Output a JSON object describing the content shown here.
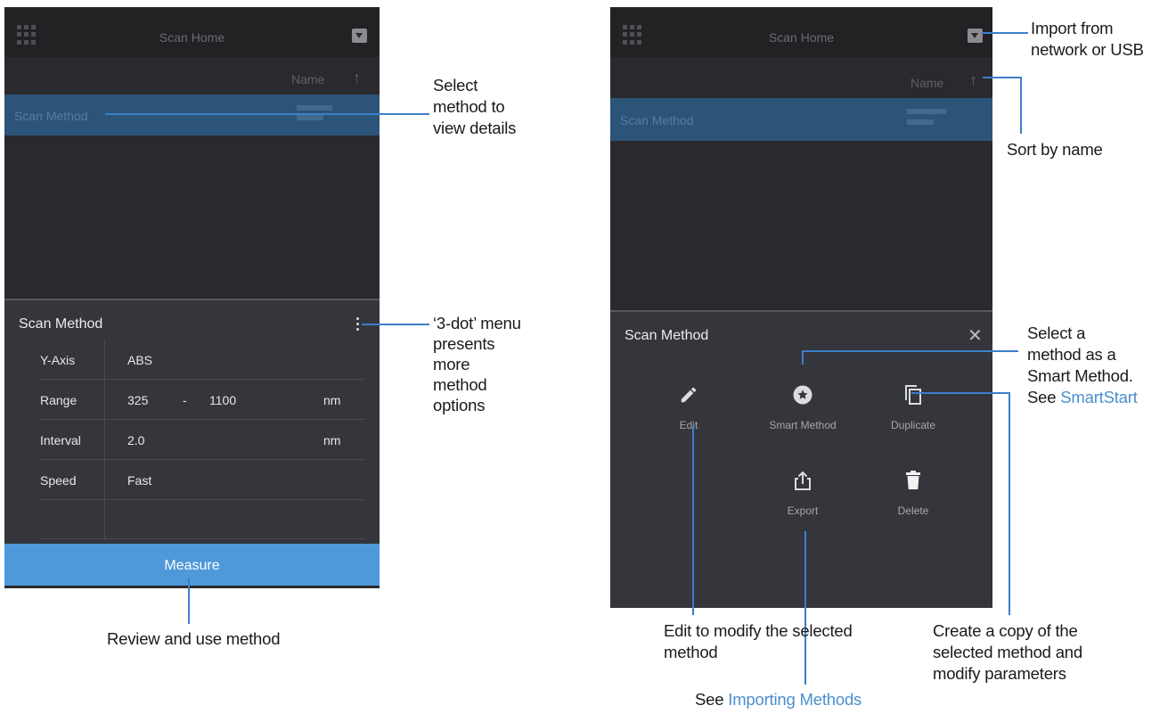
{
  "left_screen": {
    "header_title": "Scan Home",
    "sort_label": "Name",
    "sort_arrow": "↑",
    "method_row": "Scan Method",
    "panel_title": "Scan Method",
    "params": [
      {
        "key": "Y-Axis",
        "value": "ABS",
        "dash": "",
        "value2": "",
        "unit": ""
      },
      {
        "key": "Range",
        "value": "325",
        "dash": "-",
        "value2": "1100",
        "unit": "nm"
      },
      {
        "key": "Interval",
        "value": "2.0",
        "dash": "",
        "value2": "",
        "unit": "nm"
      },
      {
        "key": "Speed",
        "value": "Fast",
        "dash": "",
        "value2": "",
        "unit": ""
      }
    ],
    "measure_label": "Measure"
  },
  "right_screen": {
    "header_title": "Scan Home",
    "sort_label": "Name",
    "sort_arrow": "↑",
    "method_row": "Scan Method",
    "panel_title": "Scan Method",
    "close_glyph": "✕",
    "actions": [
      {
        "label": "Edit",
        "icon": "pencil-icon"
      },
      {
        "label": "Smart Method",
        "icon": "star-circle-icon"
      },
      {
        "label": "Duplicate",
        "icon": "copy-icon"
      },
      {
        "label": "Export",
        "icon": "share-icon"
      },
      {
        "label": "Delete",
        "icon": "trash-icon"
      }
    ]
  },
  "callouts": {
    "select_method": [
      "Select",
      "method to",
      "view details"
    ],
    "three_dot": [
      "‘3-dot’ menu",
      "presents",
      "more",
      "method",
      "options"
    ],
    "review": "Review and use method",
    "import": [
      "Import from",
      "network or USB"
    ],
    "sort": "Sort by name",
    "smart": [
      "Select a",
      "method as a",
      "Smart Method."
    ],
    "smart_see": "See ",
    "smart_link": "SmartStart",
    "edit": [
      "Edit to modify the selected",
      "method"
    ],
    "copy": [
      "Create a copy of the",
      "selected method and",
      "modify parameters"
    ],
    "export_see": "See ",
    "export_link": "Importing Methods"
  },
  "colors": {
    "screen_bg": "#2a2a2e",
    "selected_row": "#2c5478",
    "measure_button": "#4f98d9",
    "callout_line": "#3d7ec8",
    "link": "#4a8fcf"
  }
}
